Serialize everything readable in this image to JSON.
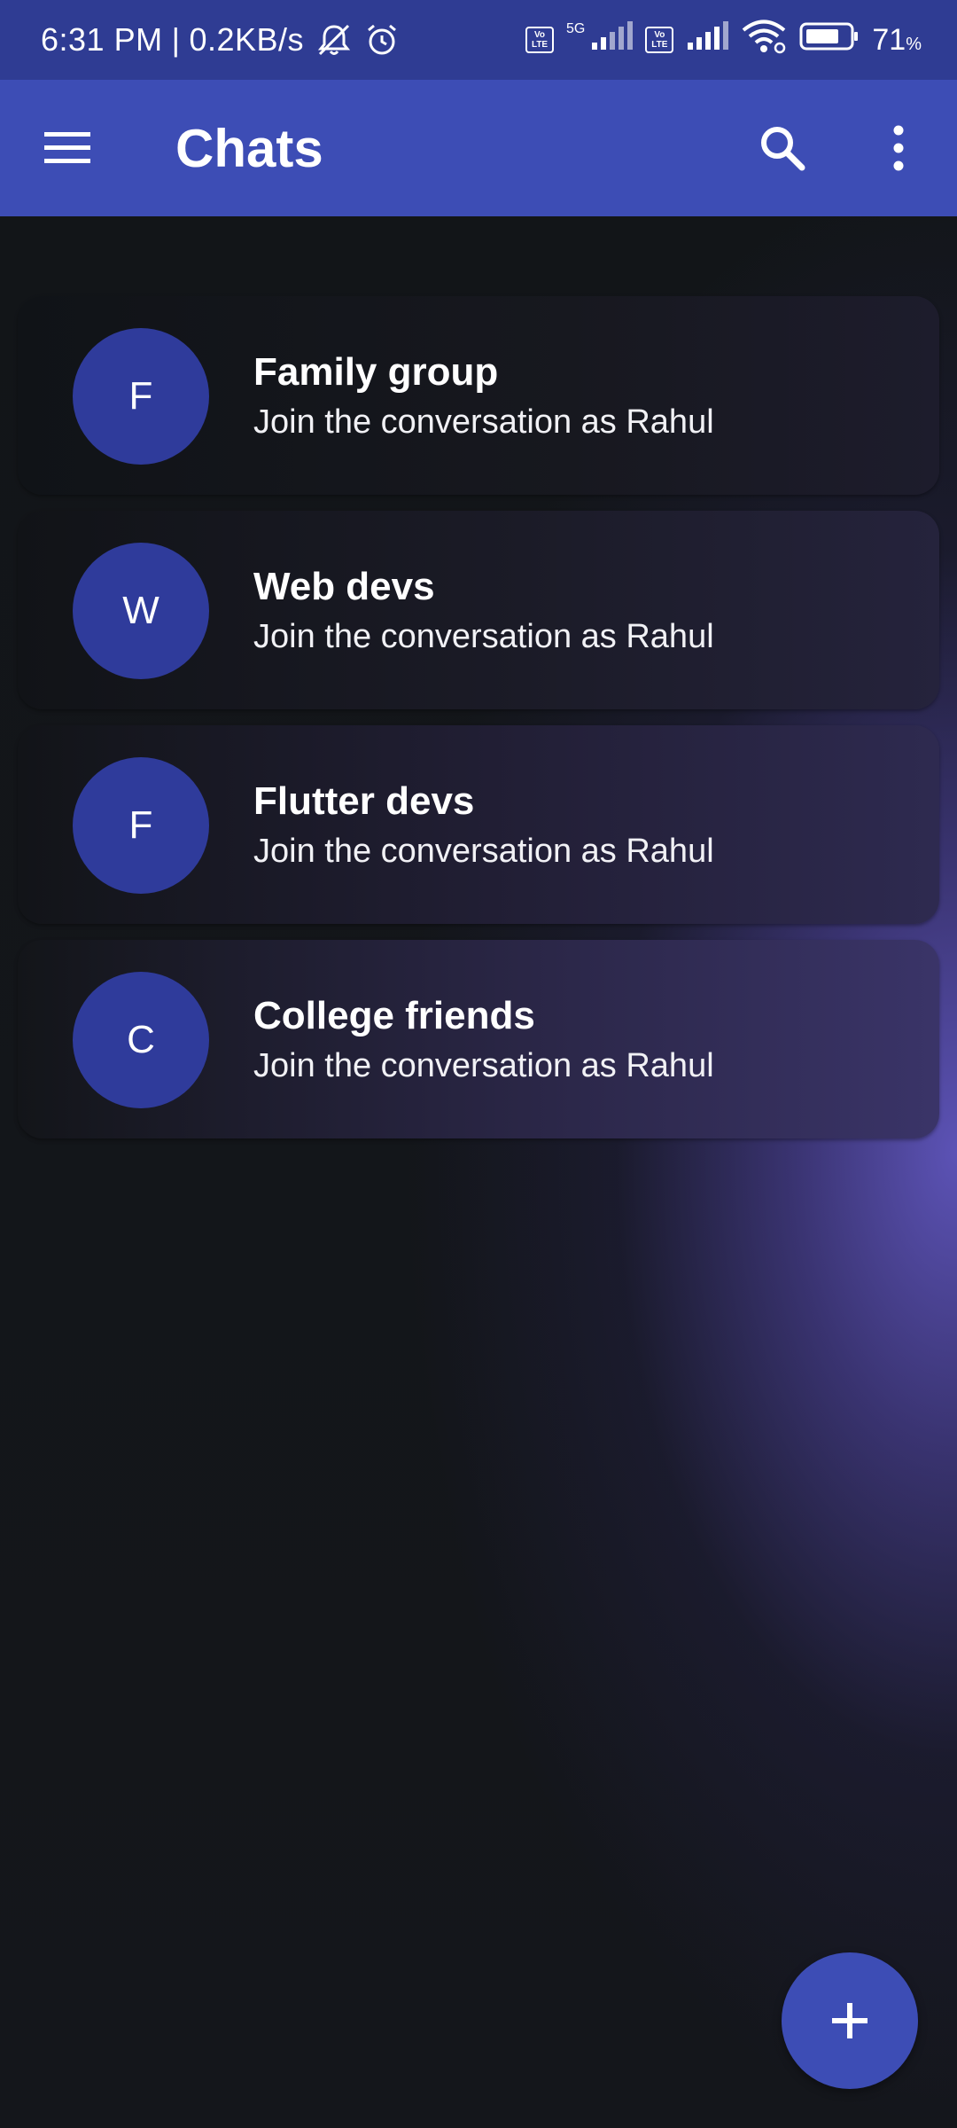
{
  "status_bar": {
    "time": "6:31 PM",
    "separator": "|",
    "net_speed": "0.2KB/s",
    "icons": [
      "mute-notifications-icon",
      "alarm-icon",
      "volte-icon",
      "signal-icon",
      "wifi-icon",
      "battery-icon"
    ],
    "volte_label_top": "Vo",
    "volte_label_bottom": "LTE",
    "network_type": "5G",
    "battery_percent": "71",
    "battery_unit": "%"
  },
  "app_bar": {
    "title": "Chats",
    "icons": [
      "menu-icon",
      "search-icon",
      "more-vert-icon"
    ],
    "color": "#3d4db5"
  },
  "chats": [
    {
      "initial": "F",
      "name": "Family group",
      "subtitle": "Join the conversation as Rahul"
    },
    {
      "initial": "W",
      "name": "Web devs",
      "subtitle": "Join the conversation as Rahul"
    },
    {
      "initial": "F",
      "name": "Flutter devs",
      "subtitle": "Join the conversation as Rahul"
    },
    {
      "initial": "C",
      "name": "College friends",
      "subtitle": "Join the conversation as Rahul"
    }
  ],
  "fab": {
    "icon": "add-icon",
    "color": "#3d4db5"
  },
  "colors": {
    "avatar": "#2f3b9b",
    "status_bar": "#2f3c93",
    "background": "#111417"
  }
}
